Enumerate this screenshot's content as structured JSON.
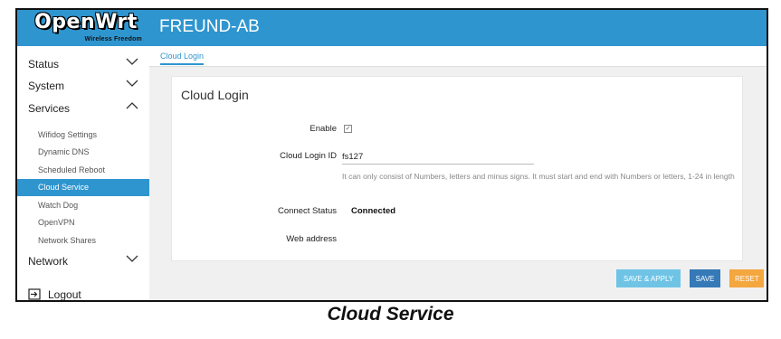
{
  "header": {
    "logo_text": "OpenWrt",
    "logo_tagline": "Wireless Freedom",
    "hostname": "FREUND-AB"
  },
  "sidebar": {
    "items": [
      {
        "label": "Status"
      },
      {
        "label": "System"
      },
      {
        "label": "Services"
      },
      {
        "label": "Network"
      }
    ],
    "services_sub": [
      {
        "label": "Wifidog Settings"
      },
      {
        "label": "Dynamic DNS"
      },
      {
        "label": "Scheduled Reboot"
      },
      {
        "label": "Cloud Service"
      },
      {
        "label": "Watch Dog"
      },
      {
        "label": "OpenVPN"
      },
      {
        "label": "Network Shares"
      }
    ],
    "active_sub": "Cloud Service",
    "logout_label": "Logout"
  },
  "tabs": [
    {
      "label": "Cloud Login"
    }
  ],
  "panel": {
    "title": "Cloud Login",
    "enable_label": "Enable",
    "enable_checked": true,
    "cloud_login_id_label": "Cloud Login ID",
    "cloud_login_id_value": "fs127",
    "cloud_login_id_hint": "It can only consist of Numbers, letters and minus signs. It must start and end with Numbers or letters, 1-24 in length",
    "connect_status_label": "Connect Status",
    "connect_status_value": "Connected",
    "web_address_label": "Web address"
  },
  "actions": {
    "save_apply": "SAVE & APPLY",
    "save": "SAVE",
    "reset": "RESET"
  },
  "caption": "Cloud Service",
  "colors": {
    "accent": "#2f95cf",
    "save_apply": "#6fc4e6",
    "save": "#3579b7",
    "reset": "#f4a63f"
  }
}
